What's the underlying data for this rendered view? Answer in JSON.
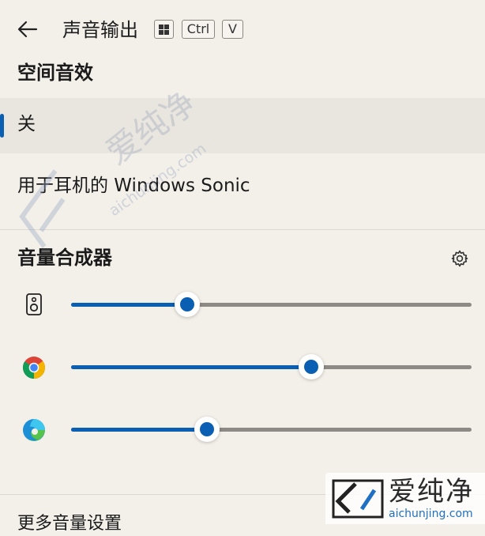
{
  "header": {
    "title": "声音输出",
    "shortcut_keys": [
      "Ctrl",
      "V"
    ],
    "back_icon": "arrow-left-icon",
    "windows_key_icon": "windows-logo-icon"
  },
  "spatial_sound": {
    "title": "空间音效",
    "options": [
      {
        "label": "关",
        "selected": true
      },
      {
        "label": "用于耳机的 Windows Sonic",
        "selected": false
      }
    ]
  },
  "volume_mixer": {
    "title": "音量合成器",
    "settings_icon": "gear-icon",
    "apps": [
      {
        "icon": "speaker-icon",
        "volume": 0.29
      },
      {
        "icon": "chrome-icon",
        "volume": 0.6
      },
      {
        "icon": "edge-icon",
        "volume": 0.34
      }
    ]
  },
  "footer": {
    "more_settings": "更多音量设置"
  },
  "watermark": {
    "center_text": "爱纯净",
    "center_url": "aichunjing.com",
    "corner_text": "爱纯净",
    "corner_url": "aichunjing.com"
  },
  "colors": {
    "accent": "#0a5fb3",
    "background": "#f3efe9",
    "selected_bg": "#e9e5df",
    "track": "#8d8985"
  }
}
